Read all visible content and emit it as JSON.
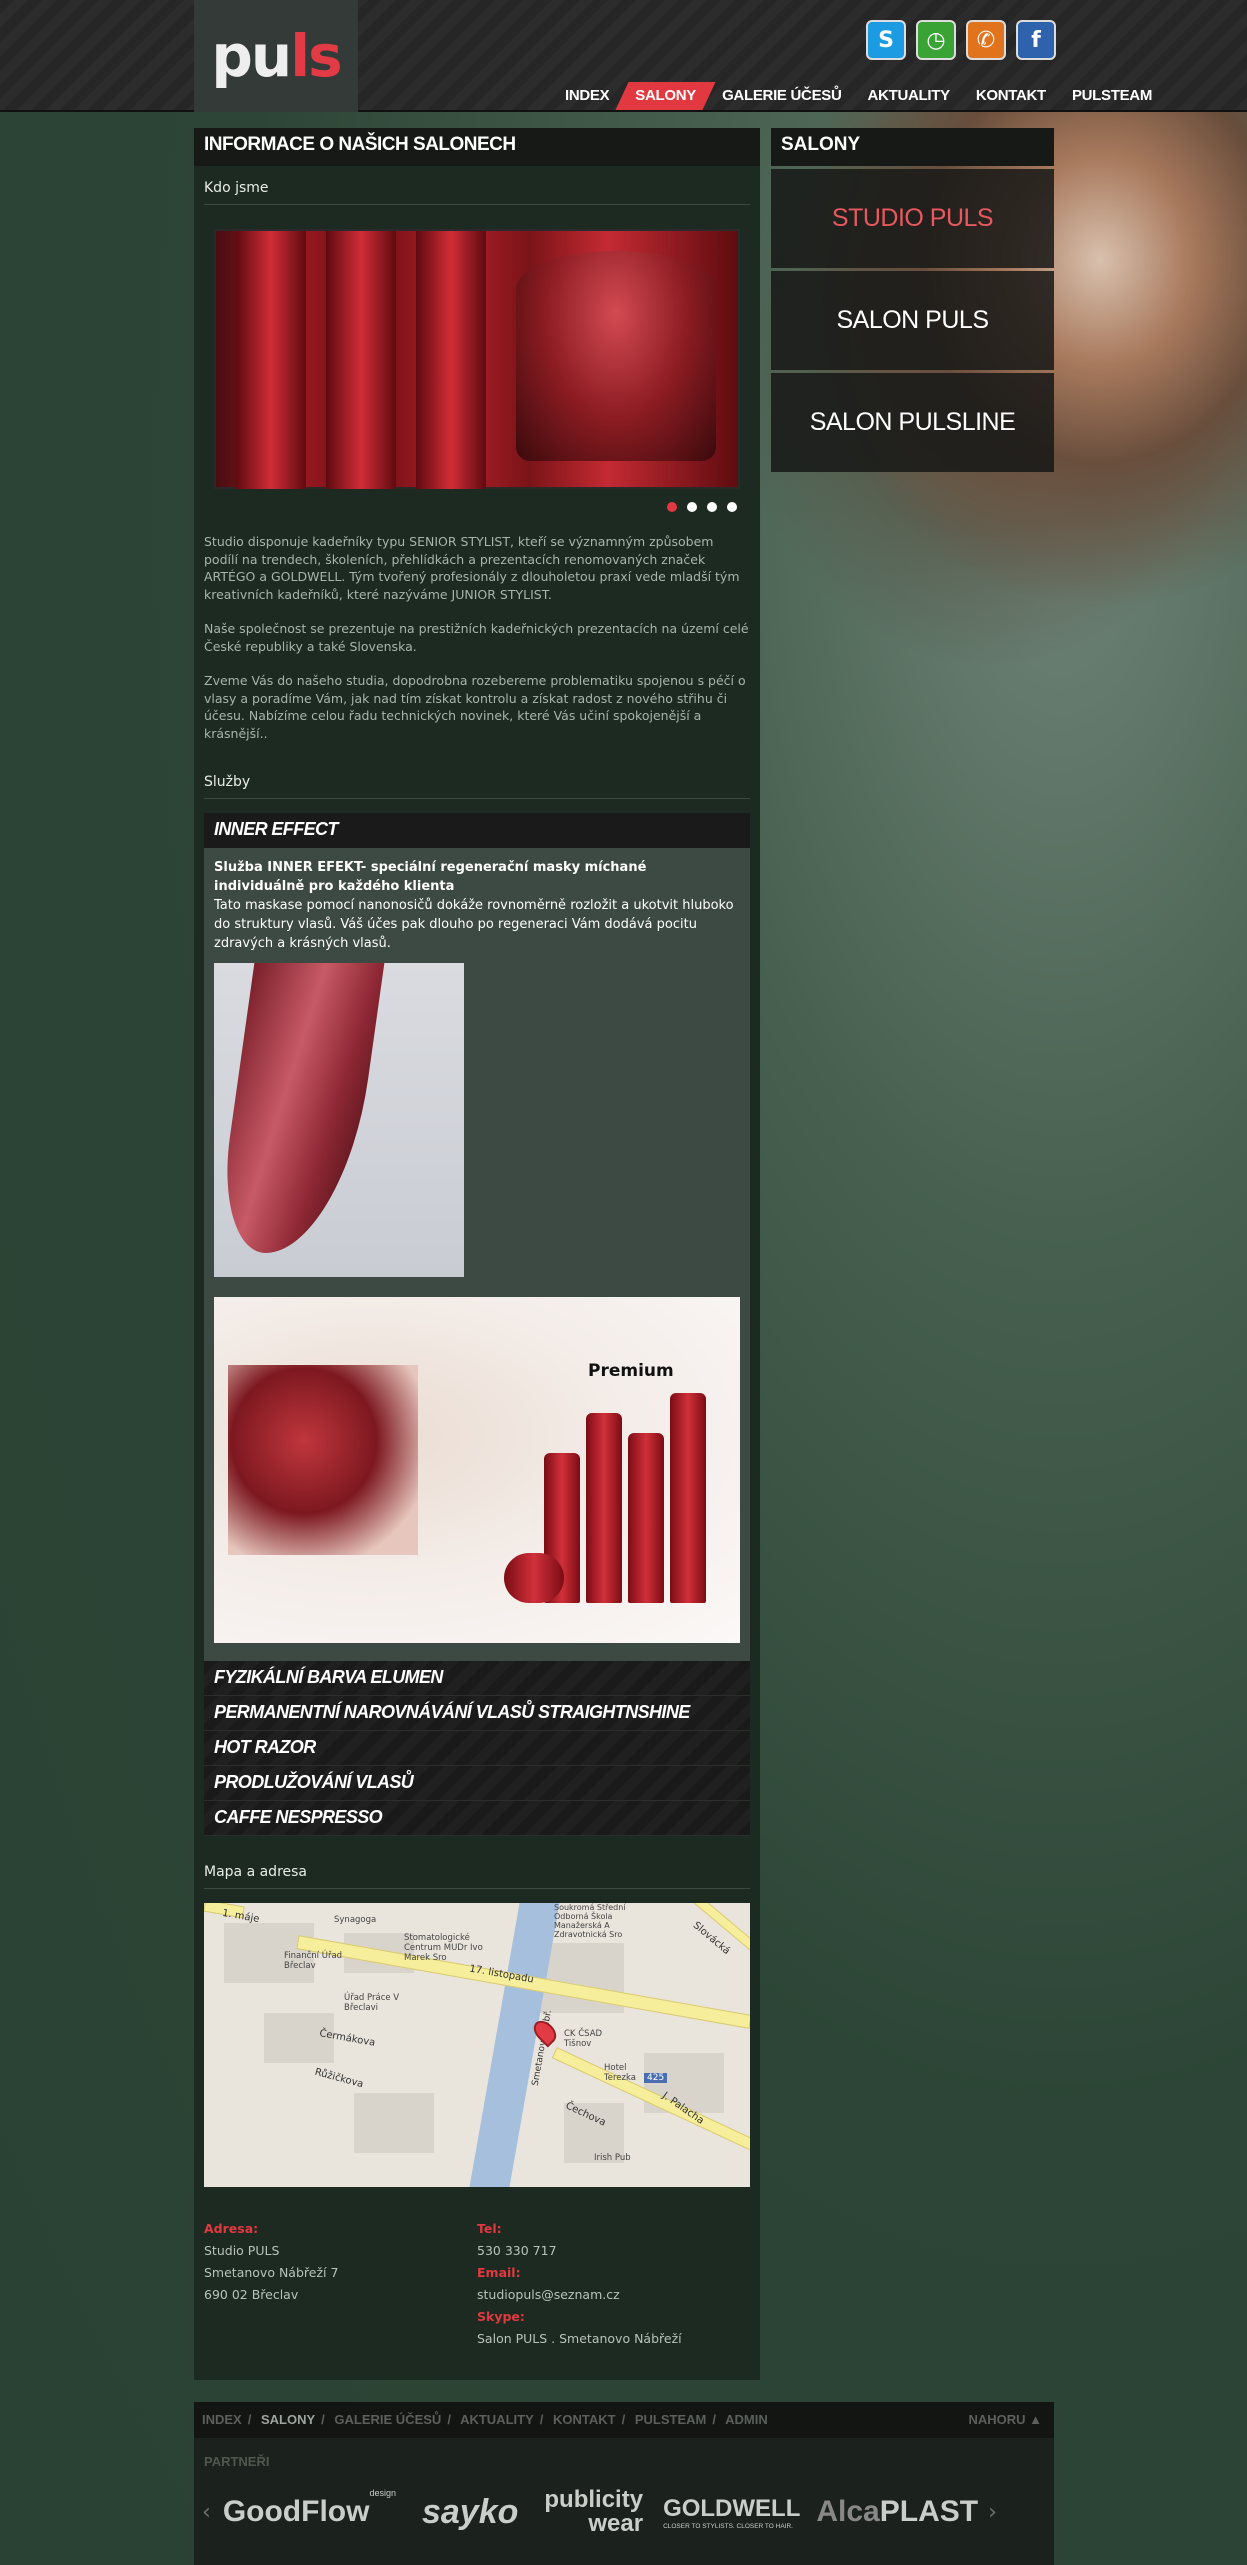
{
  "brand": {
    "logo_main": "pu",
    "logo_accent": "ls"
  },
  "social": [
    {
      "name": "skype-icon",
      "glyph": "S",
      "color": "#1a9be2"
    },
    {
      "name": "clock-icon",
      "glyph": "◷",
      "color": "#3aa335"
    },
    {
      "name": "phone-icon",
      "glyph": "✆",
      "color": "#e0731c"
    },
    {
      "name": "facebook-icon",
      "glyph": "f",
      "color": "#2e62ad"
    }
  ],
  "nav": [
    {
      "label": "INDEX",
      "active": false
    },
    {
      "label": "SALONY",
      "active": true
    },
    {
      "label": "GALERIE ÚČESŮ",
      "active": false
    },
    {
      "label": "AKTUALITY",
      "active": false
    },
    {
      "label": "KONTAKT",
      "active": false
    },
    {
      "label": "PULSTEAM",
      "active": false
    }
  ],
  "main": {
    "title": "INFORMACE O NAŠICH SALONECH",
    "about_heading": "Kdo jsme",
    "paragraphs": [
      "Studio disponuje kadeřníky typu SENIOR STYLIST, kteří se významným způsobem podílí na trendech, školeních, přehlídkách a prezentacích renomovaných značek ARTÉGO a GOLDWELL. Tým tvořený profesionály z dlouholetou praxí vede mladší tým kreativních kadeřníků, které nazýváme JUNIOR STYLIST.",
      "Naše společnost se prezentuje na prestižních kadeřnických prezentacích na území celé České republiky a také Slovenska.",
      "Zveme Vás do našeho studia, dopodrobna rozebereme problematiku spojenou s péčí o vlasy a poradíme Vám, jak nad tím získat kontrolu a získat radost z nového střihu či účesu. Nabízíme celou řadu technických novinek, které Vás učiní spokojenější a krásnější.."
    ],
    "services_heading": "Služby",
    "accordion_open": {
      "title": "INNER EFFECT",
      "bold": "Služba INNER EFEKT- speciální regenerační masky míchané individuálně pro každého klienta",
      "text": "Tato maskase pomocí nanonosičů dokáže rovnoměrně rozložit a ukotvit hluboko do struktury vlasů. Váš účes pak dlouho po regeneraci Vám dodává pocitu zdravých a krásných vlasů.",
      "image_label": "Premium"
    },
    "accordion_closed": [
      "FYZIKÁLNÍ BARVA ELUMEN",
      "PERMANENTNÍ NAROVNÁVÁNÍ VLASŮ STRAIGHTNSHINE",
      "HOT RAZOR",
      "PRODLUŽOVÁNÍ VLASŮ",
      "CAFFE NESPRESSO"
    ],
    "map_heading": "Mapa a adresa",
    "map_labels": {
      "street1": "17. listopadu",
      "street2": "Čechova",
      "street3": "J. Palacha",
      "street4": "Slovácká",
      "street5": "1. máje",
      "street6": "Čermákova",
      "street7": "Růžičkova",
      "street8": "Smetanovo nábř.",
      "poi1": "Stomatologické Centrum MUDr Ivo Marek Sro",
      "poi2": "Finanční Úřad Břeclav",
      "poi3": "Úřad Práce V Břeclavi",
      "poi4": "CK ČSAD Tišnov",
      "poi5": "Hotel Terezka",
      "poi6": "Irish Pub",
      "poi7": "Synagoga",
      "poi8": "Soukromá Střední Odborná Škola Manažerská A Zdravotnická Sro",
      "road_badge": "425"
    },
    "address": {
      "label": "Adresa:",
      "lines": [
        "Studio PULS",
        "Smetanovo Nábřeží 7",
        "690 02 Břeclav"
      ]
    },
    "tel": {
      "label": "Tel:",
      "value": "530 330 717"
    },
    "email": {
      "label": "Email:",
      "value": "studiopuls@seznam.cz"
    },
    "skype": {
      "label": "Skype:",
      "value": "Salon PULS . Smetanovo Nábřeží"
    }
  },
  "sidebar": {
    "title": "SALONY",
    "items": [
      {
        "label": "STUDIO PULS",
        "active": true
      },
      {
        "label": "SALON PULS",
        "active": false
      },
      {
        "label": "SALON PULSLINE",
        "active": false
      }
    ]
  },
  "footer": {
    "links": [
      "INDEX",
      "SALONY",
      "GALERIE ÚČESŮ",
      "AKTUALITY",
      "KONTAKT",
      "PULSTEAM",
      "ADMIN"
    ],
    "active_index": 1,
    "up_label": "NAHORU ▲",
    "partners_title": "PARTNEŘI",
    "partners": [
      "GoodFlow",
      "design",
      "sayko",
      "publicity",
      "wear",
      "GOLDWELL",
      "CLOSER TO STYLISTS. CLOSER TO HAIR.",
      "Alca",
      "PLAST"
    ],
    "arrow_left": "‹",
    "arrow_right": "›"
  }
}
